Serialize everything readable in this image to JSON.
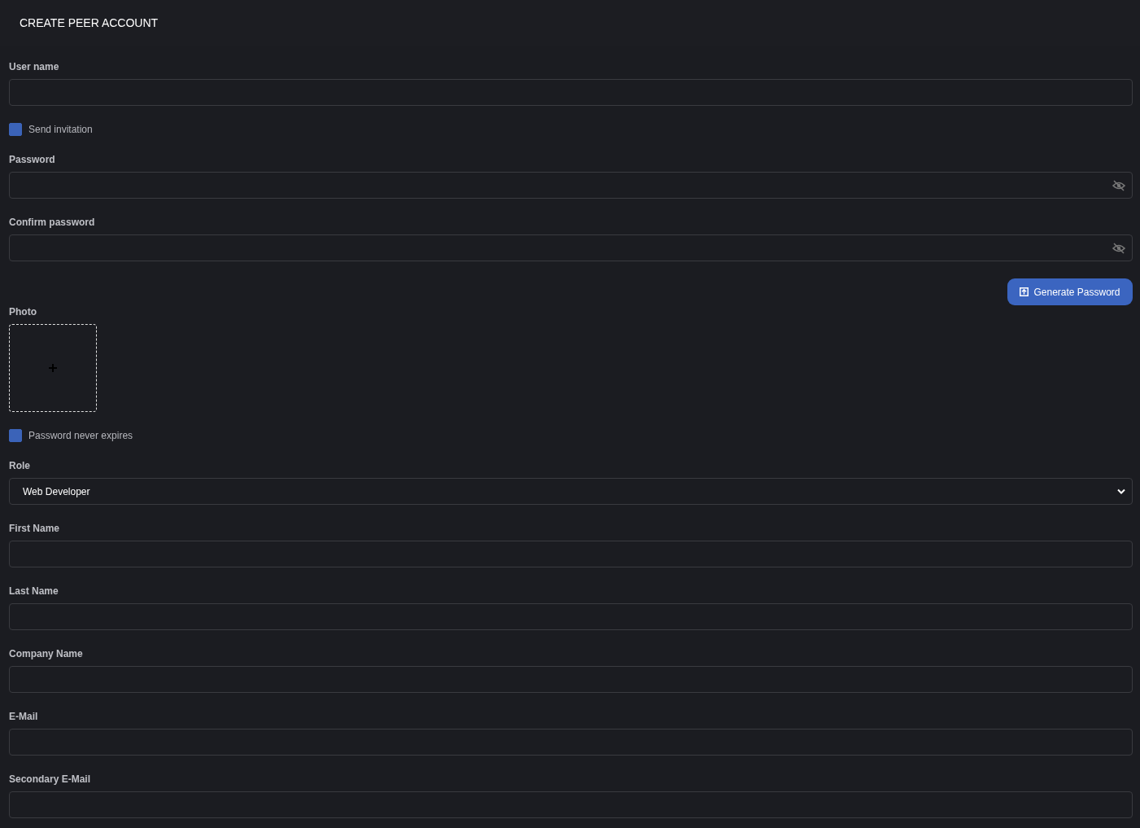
{
  "header": {
    "title": "CREATE PEER ACCOUNT"
  },
  "form": [
    {
      "kind": "text",
      "label": "User name"
    },
    {
      "kind": "checkbox",
      "label": "Send invitation",
      "checked": true
    },
    {
      "kind": "password",
      "label": "Password"
    },
    {
      "kind": "password",
      "label": "Confirm password"
    },
    {
      "kind": "button",
      "label": "Generate Password"
    },
    {
      "kind": "photo",
      "label": "Photo"
    },
    {
      "kind": "checkbox",
      "label": "Password never expires",
      "checked": true
    },
    {
      "kind": "select",
      "label": "Role",
      "value": "Web Developer"
    },
    {
      "kind": "text",
      "label": "First Name"
    },
    {
      "kind": "text",
      "label": "Last Name"
    },
    {
      "kind": "text",
      "label": "Company Name"
    },
    {
      "kind": "text",
      "label": "E-Mail"
    },
    {
      "kind": "text",
      "label": "Secondary E-Mail"
    }
  ]
}
